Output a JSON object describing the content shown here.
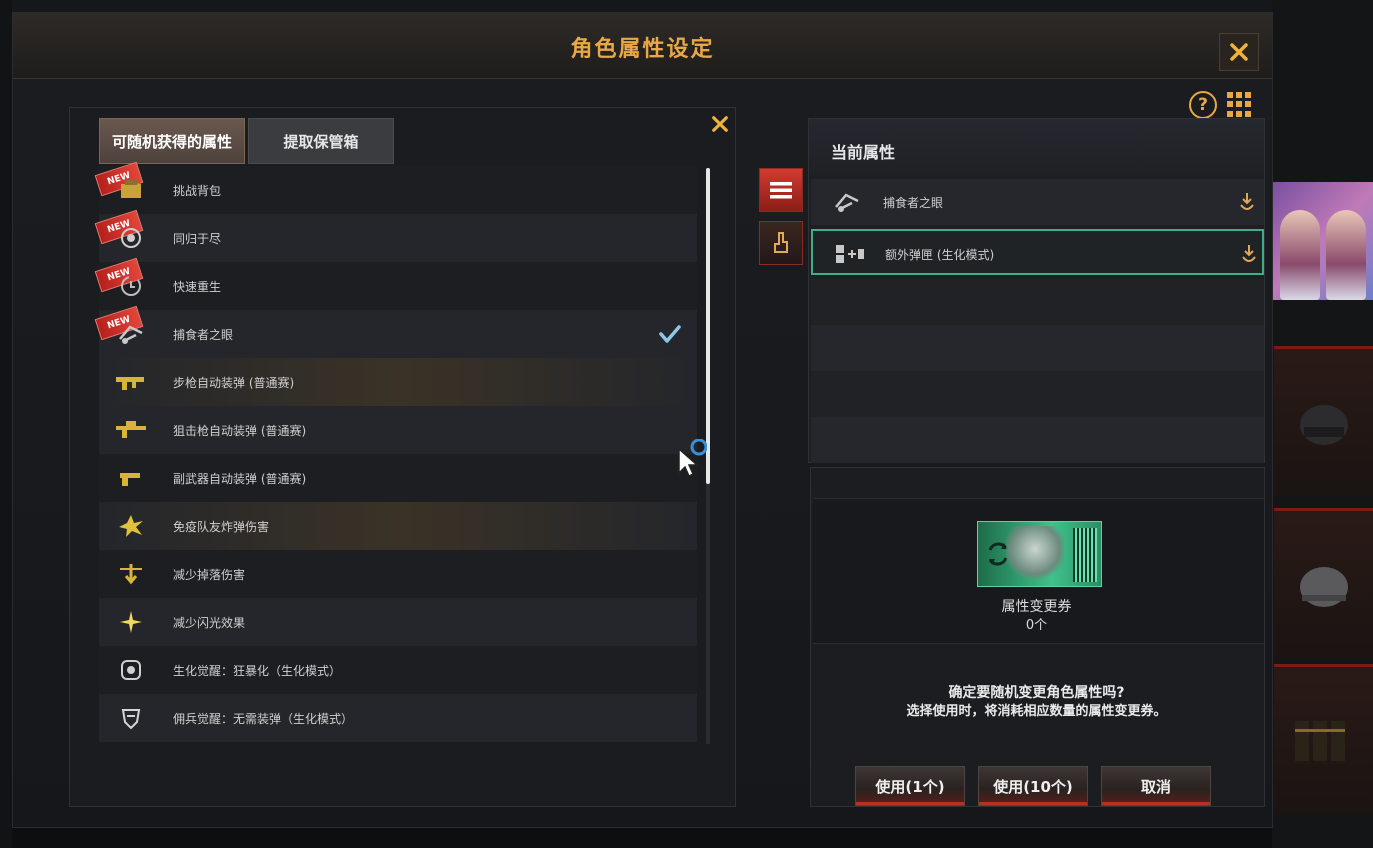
{
  "dialog": {
    "title": "角色属性设定"
  },
  "left_panel": {
    "tabs": [
      {
        "label": "可随机获得的属性",
        "active": true
      },
      {
        "label": "提取保管箱",
        "active": false
      }
    ],
    "items": [
      {
        "label": "挑战背包",
        "new": true,
        "checked": false
      },
      {
        "label": "同归于尽",
        "new": true,
        "checked": false
      },
      {
        "label": "快速重生",
        "new": true,
        "checked": false
      },
      {
        "label": "捕食者之眼",
        "new": true,
        "checked": true
      },
      {
        "label": "步枪自动装弹 (普通赛)",
        "new": false,
        "checked": false
      },
      {
        "label": "狙击枪自动装弹 (普通赛)",
        "new": false,
        "checked": false
      },
      {
        "label": "副武器自动装弹 (普通赛)",
        "new": false,
        "checked": false
      },
      {
        "label": "免疫队友炸弹伤害",
        "new": false,
        "checked": false
      },
      {
        "label": "减少掉落伤害",
        "new": false,
        "checked": false
      },
      {
        "label": "减少闪光效果",
        "new": false,
        "checked": false
      },
      {
        "label": "生化觉醒：狂暴化（生化模式）",
        "new": false,
        "checked": false
      },
      {
        "label": "佣兵觉醒：无需装弹（生化模式）",
        "new": false,
        "checked": false
      }
    ],
    "new_badge_text": "NEW"
  },
  "current_attributes": {
    "title": "当前属性",
    "items": [
      {
        "label": "捕食者之眼"
      },
      {
        "label": "额外弹匣 (生化模式)"
      }
    ]
  },
  "ticket": {
    "name": "属性变更券",
    "count": "0个"
  },
  "confirm": {
    "line1": "确定要随机变更角色属性吗?",
    "line2": "选择使用时，将消耗相应数量的属性变更券。"
  },
  "buttons": {
    "use_1": "使用(1个)",
    "use_10": "使用(10个)",
    "cancel": "取消"
  },
  "colors": {
    "accent_gold": "#e9a846",
    "accent_red": "#d33a30",
    "selected_border": "#3fae86"
  }
}
